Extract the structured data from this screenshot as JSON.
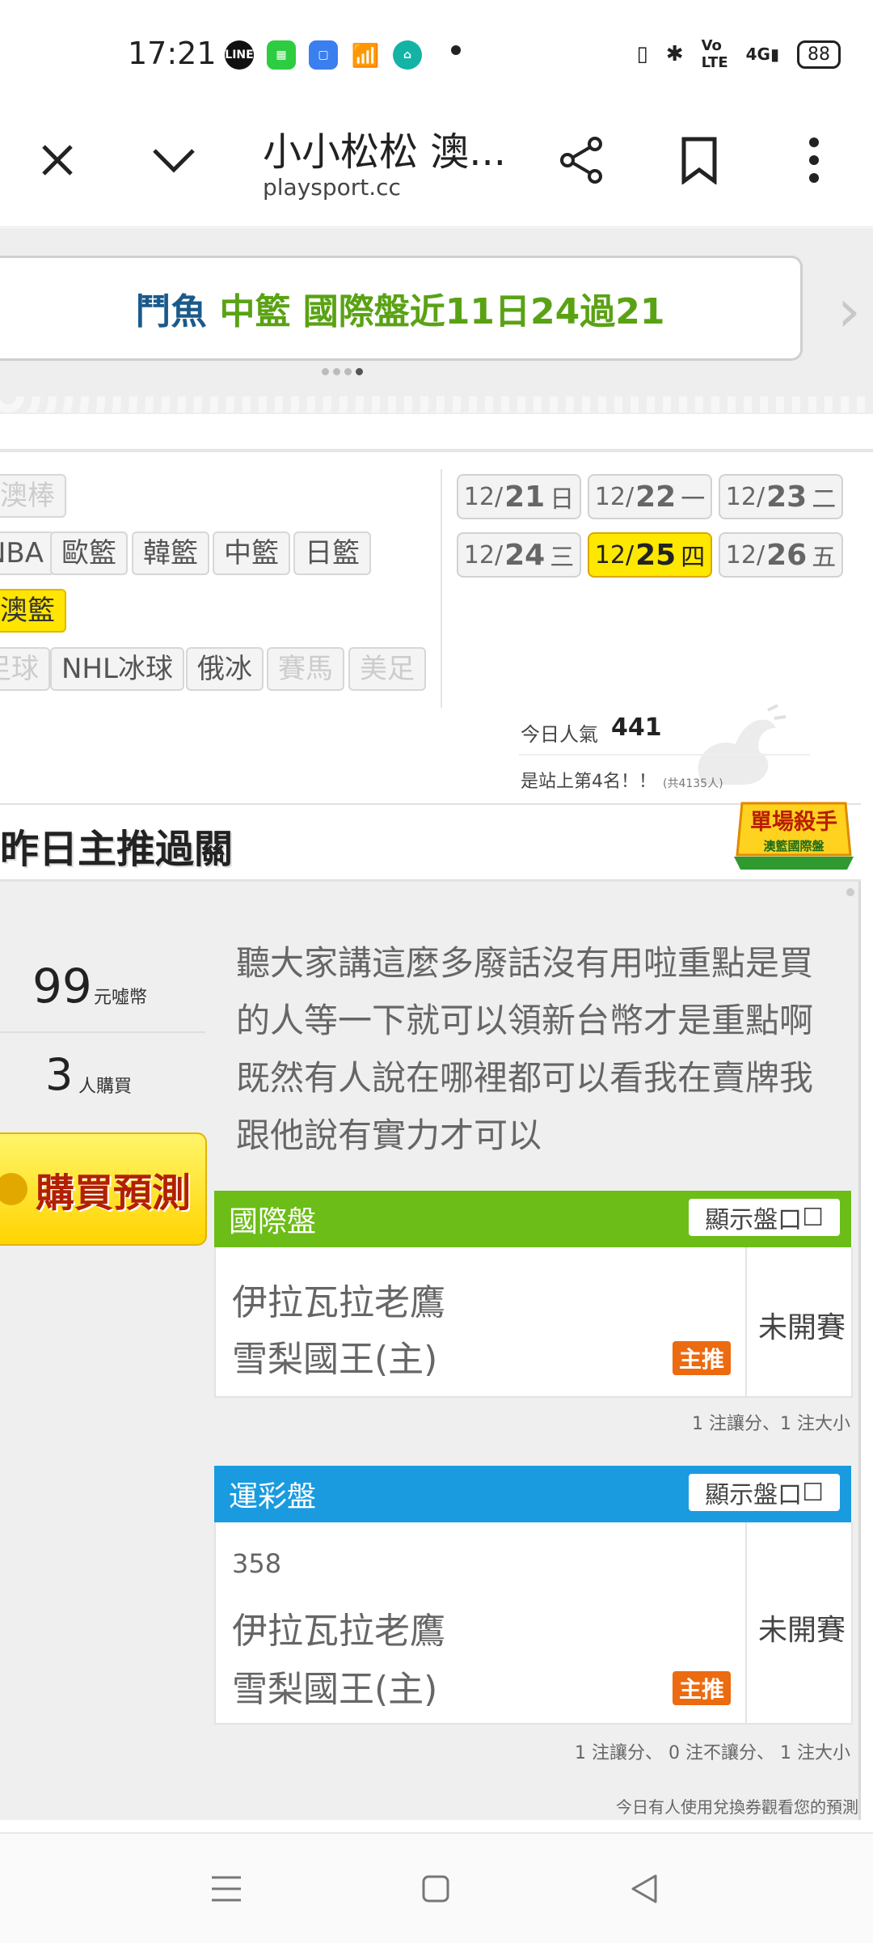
{
  "status_bar": {
    "time": "17:21",
    "battery": "88",
    "network": "4G",
    "app_icons": [
      "line-icon",
      "green-app-icon",
      "blue-app-icon",
      "stocks-icon",
      "teal-app-icon"
    ]
  },
  "browser": {
    "title": "小小松松 澳...",
    "domain": "playsport.cc"
  },
  "banner": {
    "part1": "鬥魚",
    "part2": "中籃 國際盤近11日24過21",
    "next_arrow": "›"
  },
  "leagues": {
    "row1": [
      "澳棒"
    ],
    "row2": [
      "NBA",
      "歐籃",
      "韓籃",
      "中籃",
      "日籃"
    ],
    "row3": [
      "澳籃"
    ],
    "row4": [
      "足球",
      "NHL冰球",
      "俄冰",
      "賽馬",
      "美足"
    ]
  },
  "dates": [
    {
      "md": "12/",
      "day": "21",
      "wd": "日"
    },
    {
      "md": "12/",
      "day": "22",
      "wd": "一"
    },
    {
      "md": "12/",
      "day": "23",
      "wd": "二"
    },
    {
      "md": "12/",
      "day": "24",
      "wd": "三"
    },
    {
      "md": "12/",
      "day": "25",
      "wd": "四"
    },
    {
      "md": "12/",
      "day": "26",
      "wd": "五"
    }
  ],
  "popularity": {
    "label": "今日人氣",
    "value": "441",
    "rank": "是站上第4名！！",
    "rank_total": "(共4135人)"
  },
  "pick": {
    "title": "昨日主推過關",
    "badge_line1": "單場殺手",
    "badge_line2": "澳籃國際盤"
  },
  "price": {
    "value": "99",
    "unit": "元噓幣",
    "buyers_value": "3",
    "buyers_unit": "人購買",
    "buy_button": "購買預測"
  },
  "intro": "聽大家講這麼多廢話沒有用啦重點是買的人等一下就可以領新台幣才是重點啊既然有人說在哪裡都可以看我在賣牌我跟他說有實力才可以",
  "international": {
    "label": "國際盤",
    "show_button": "顯示盤口",
    "team1": "伊拉瓦拉老鷹",
    "team2": "雪梨國王(主)",
    "main_tag": "主推",
    "status": "未開賽",
    "note": "1 注讓分、1 注大小",
    "color": "#6cbd17"
  },
  "sports_lottery": {
    "label": "運彩盤",
    "show_button": "顯示盤口",
    "game_no": "358",
    "team1": "伊拉瓦拉老鷹",
    "team2": "雪梨國王(主)",
    "main_tag": "主推",
    "status": "未開賽",
    "note": "1 注讓分、 0 注不讓分、 1 注大小",
    "color": "#1a9be0"
  },
  "footer_note": "今日有人使用兌換券觀看您的預測"
}
